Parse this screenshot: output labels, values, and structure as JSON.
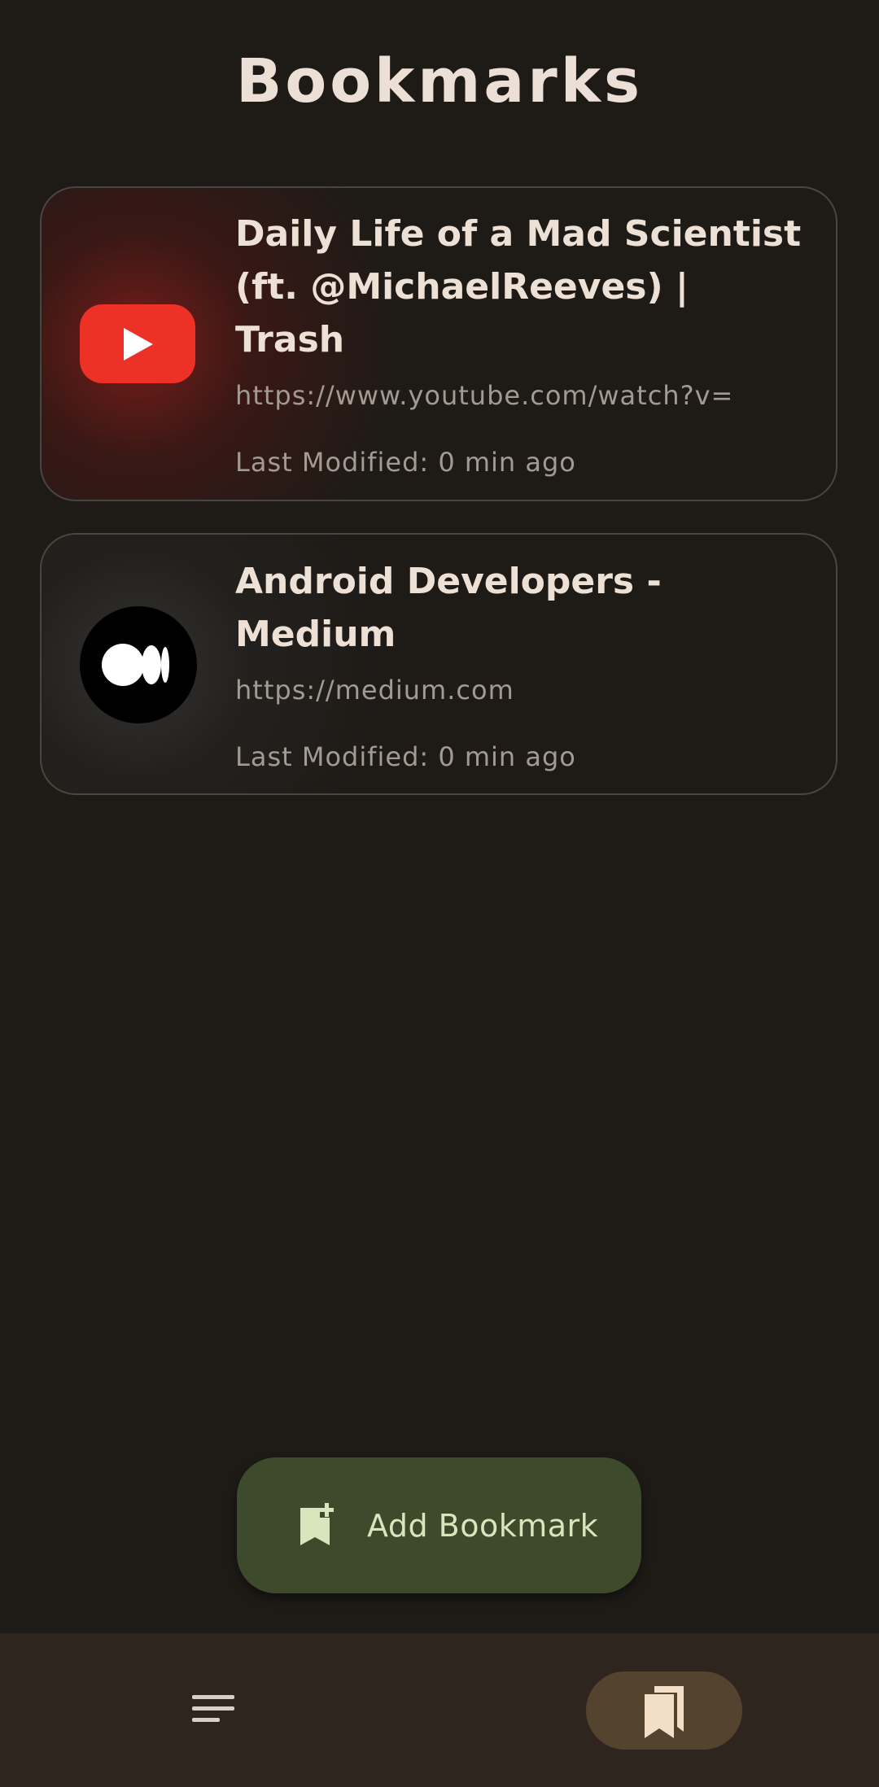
{
  "header": {
    "title": "Bookmarks"
  },
  "bookmarks": [
    {
      "title": "Daily Life of a Mad Scientist (ft. @MichaelReeves) | Trash",
      "url": "https://www.youtube.com/watch?v=",
      "modified": "Last Modified: 0 min ago",
      "icon": "youtube-icon"
    },
    {
      "title": "Android Developers - Medium",
      "url": "https://medium.com",
      "modified": "Last Modified: 0 min ago",
      "icon": "medium-icon"
    }
  ],
  "fab": {
    "label": "Add Bookmark",
    "icon": "bookmark-add-icon"
  },
  "bottom_nav": {
    "items": [
      {
        "icon": "menu-icon",
        "selected": false
      },
      {
        "icon": "bookmarks-icon",
        "selected": true
      }
    ]
  },
  "colors": {
    "background": "#1e1b17",
    "fab_background": "#3d4a2c",
    "fab_text": "#d7e6bd",
    "nav_background": "#2e261e",
    "nav_selected_pill": "#54442f",
    "youtube_red": "#ed3127"
  }
}
